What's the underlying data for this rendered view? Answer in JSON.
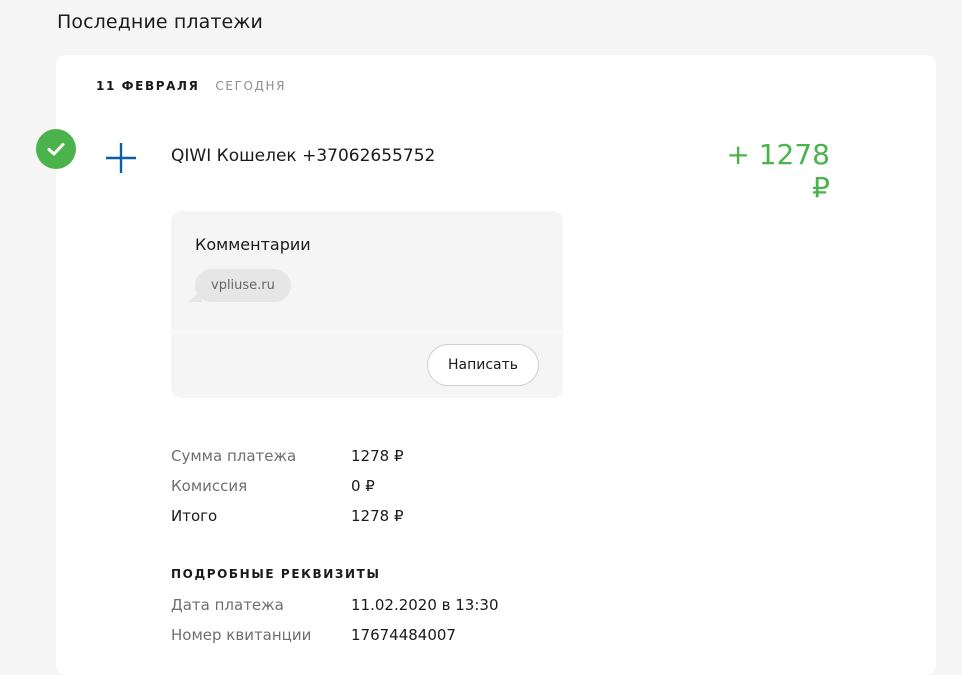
{
  "page": {
    "title": "Последние платежи"
  },
  "date_header": {
    "date": "11 февраля",
    "relative": "сегодня"
  },
  "payment": {
    "status_icon": "check-icon",
    "type_icon": "plus-icon",
    "provider": "QIWI Кошелек +37062655752",
    "amount": "+ 1278 ₽"
  },
  "comments": {
    "title": "Комментарии",
    "items": [
      "vpliuse.ru"
    ],
    "write_button": "Написать"
  },
  "summary": [
    {
      "label": "Сумма платежа",
      "value": "1278 ₽"
    },
    {
      "label": "Комиссия",
      "value": "0 ₽"
    },
    {
      "label": "Итого",
      "value": "1278 ₽"
    }
  ],
  "details": {
    "title": "Подробные реквизиты",
    "rows": [
      {
        "label": "Дата платежа",
        "value": "11.02.2020 в 13:30"
      },
      {
        "label": "Номер квитанции",
        "value": "17674484007"
      }
    ]
  },
  "colors": {
    "accent_green": "#4bb34b",
    "accent_blue": "#0a5ea8",
    "background": "#f5f5f5"
  }
}
